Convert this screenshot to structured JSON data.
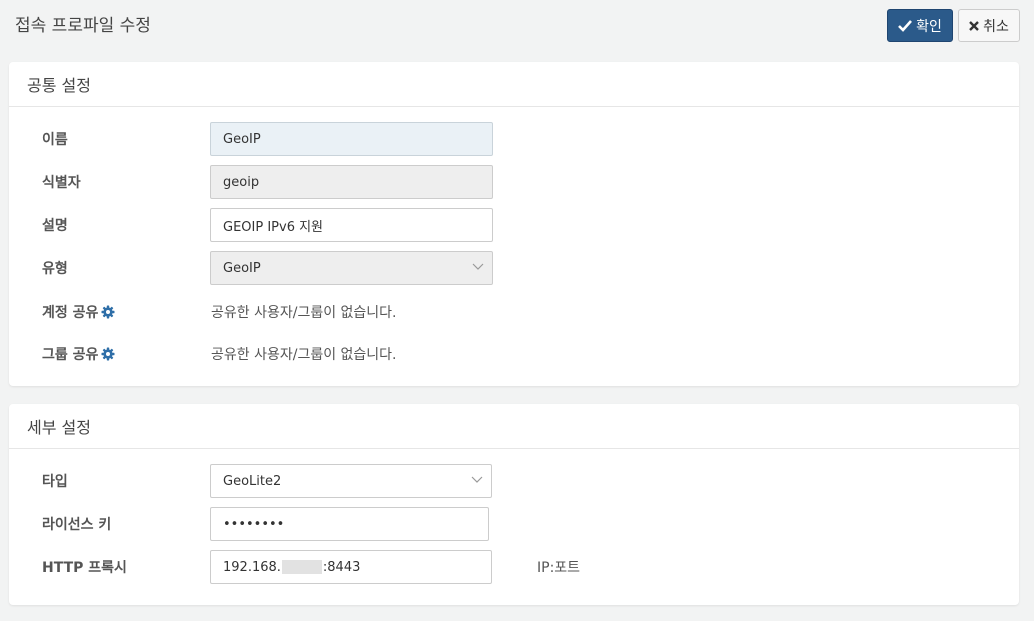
{
  "header": {
    "title": "접속 프로파일 수정",
    "ok_label": "확인",
    "cancel_label": "취소"
  },
  "common": {
    "title": "공통 설정",
    "name": {
      "label": "이름",
      "value": "GeoIP"
    },
    "identifier": {
      "label": "식별자",
      "value": "geoip"
    },
    "description": {
      "label": "설명",
      "value": "GEOIP IPv6 지원"
    },
    "type": {
      "label": "유형",
      "value": "GeoIP"
    },
    "account_share": {
      "label": "계정 공유",
      "value": "공유한 사용자/그룹이 없습니다."
    },
    "group_share": {
      "label": "그룹 공유",
      "value": "공유한 사용자/그룹이 없습니다."
    }
  },
  "detail": {
    "title": "세부 설정",
    "type": {
      "label": "타입",
      "value": "GeoLite2"
    },
    "license_key": {
      "label": "라이선스 키",
      "value": "••••••••"
    },
    "http_proxy": {
      "label": "HTTP 프록시",
      "value_prefix": "192.168.",
      "value_suffix": ":8443",
      "hint": "IP:포트"
    }
  },
  "colors": {
    "primary": "#2b5a8a",
    "gear": "#2f6fa8"
  }
}
